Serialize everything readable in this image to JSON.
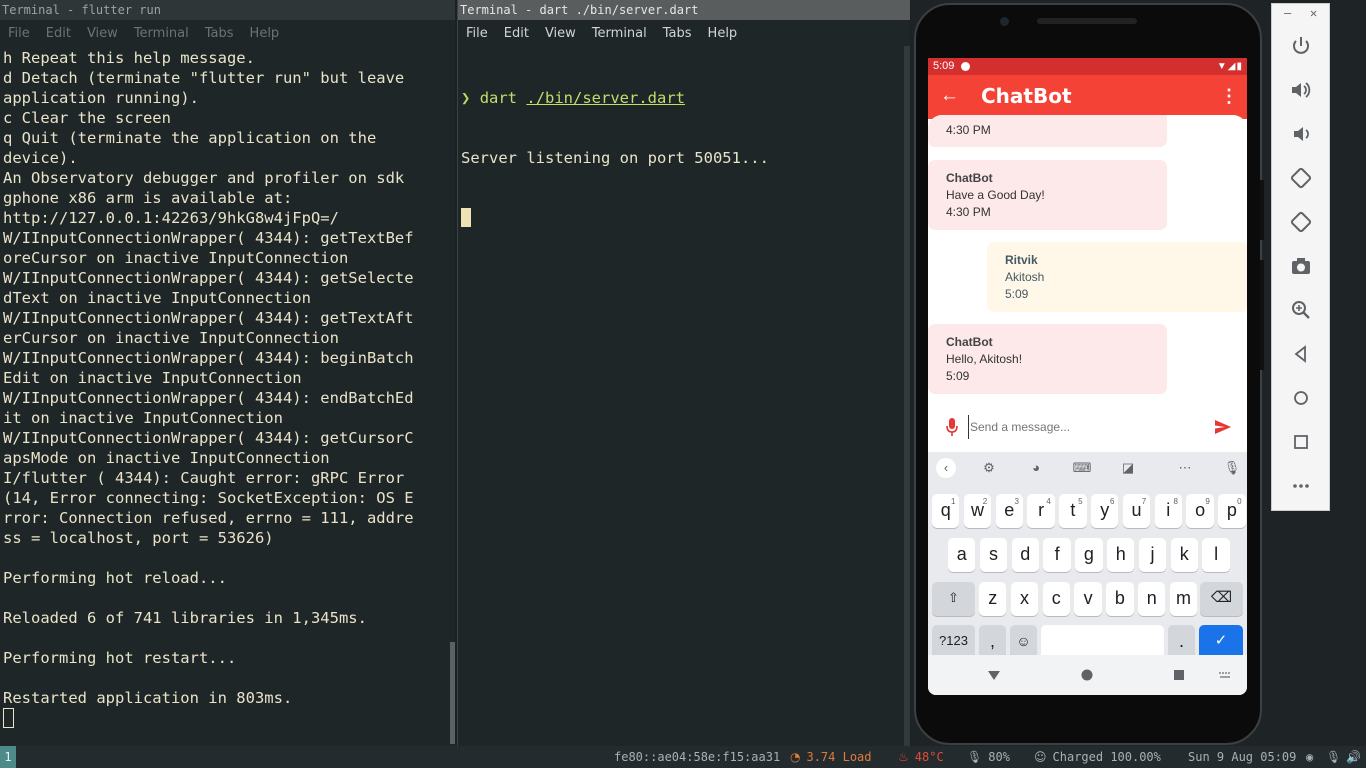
{
  "left_terminal": {
    "title": "Terminal - flutter run",
    "menu": [
      "File",
      "Edit",
      "View",
      "Terminal",
      "Tabs",
      "Help"
    ],
    "lines": [
      "h Repeat this help message.",
      "d Detach (terminate \"flutter run\" but leave",
      "application running).",
      "c Clear the screen",
      "q Quit (terminate the application on the",
      "device).",
      "An Observatory debugger and profiler on sdk",
      "gphone x86 arm is available at:",
      "http://127.0.0.1:42263/9hkG8w4jFpQ=/",
      "W/IInputConnectionWrapper( 4344): getTextBef",
      "oreCursor on inactive InputConnection",
      "W/IInputConnectionWrapper( 4344): getSelecte",
      "dText on inactive InputConnection",
      "W/IInputConnectionWrapper( 4344): getTextAft",
      "erCursor on inactive InputConnection",
      "W/IInputConnectionWrapper( 4344): beginBatch",
      "Edit on inactive InputConnection",
      "W/IInputConnectionWrapper( 4344): endBatchEd",
      "it on inactive InputConnection",
      "W/IInputConnectionWrapper( 4344): getCursorC",
      "apsMode on inactive InputConnection",
      "I/flutter ( 4344): Caught error: gRPC Error",
      "(14, Error connecting: SocketException: OS E",
      "rror: Connection refused, errno = 111, addre",
      "ss = localhost, port = 53626)",
      "",
      "Performing hot reload...",
      "",
      "Reloaded 6 of 741 libraries in 1,345ms.",
      "",
      "Performing hot restart...",
      "",
      "Restarted application in 803ms."
    ]
  },
  "right_terminal": {
    "title": "Terminal - dart ./bin/server.dart",
    "menu": [
      "File",
      "Edit",
      "View",
      "Terminal",
      "Tabs",
      "Help"
    ],
    "prompt_symbol": "❯",
    "command": "dart",
    "command_arg": "./bin/server.dart",
    "output": "Server listening on port 50051..."
  },
  "phone": {
    "status_time": "5:09",
    "app_title": "ChatBot",
    "messages": [
      {
        "sender": "",
        "text": "",
        "time": "4:30 PM",
        "side": "bot"
      },
      {
        "sender": "ChatBot",
        "text": "Have a Good Day!",
        "time": "4:30 PM",
        "side": "bot"
      },
      {
        "sender": "Ritvik",
        "text": "Akitosh",
        "time": "5:09",
        "side": "user"
      },
      {
        "sender": "ChatBot",
        "text": "Hello, Akitosh!",
        "time": "5:09",
        "side": "bot"
      }
    ],
    "input_placeholder": "Send a message...",
    "keyboard": {
      "row1": [
        [
          "q",
          "1"
        ],
        [
          "w",
          "2"
        ],
        [
          "e",
          "3"
        ],
        [
          "r",
          "4"
        ],
        [
          "t",
          "5"
        ],
        [
          "y",
          "6"
        ],
        [
          "u",
          "7"
        ],
        [
          "i",
          "8"
        ],
        [
          "o",
          "9"
        ],
        [
          "p",
          "0"
        ]
      ],
      "row2": [
        "a",
        "s",
        "d",
        "f",
        "g",
        "h",
        "j",
        "k",
        "l"
      ],
      "row3": [
        "z",
        "x",
        "c",
        "v",
        "b",
        "n",
        "m"
      ],
      "symbols_key": "?123",
      "comma_key": ",",
      "period_key": "."
    }
  },
  "status_bar": {
    "workspace": "1",
    "ip": "fe80::ae04:58e:f15:aa31",
    "load": "3.74 Load",
    "temp": "48°C",
    "volume": "80%",
    "battery": "Charged 100.00%",
    "datetime": "Sun 9 Aug 05:09"
  },
  "colors": {
    "app_red": "#f44336",
    "status_red": "#d32f2f",
    "terminal_bg": "#1f2628",
    "prompt_green": "#b7d65d",
    "keyboard_blue": "#1a73e8"
  }
}
